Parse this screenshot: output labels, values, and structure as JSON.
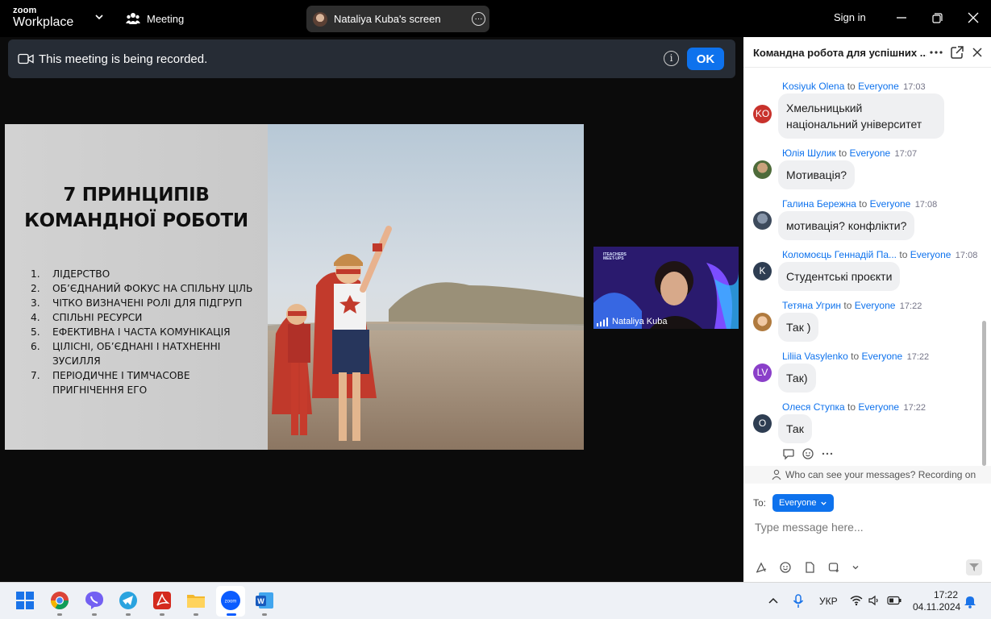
{
  "titlebar": {
    "logo_top": "zoom",
    "logo_bottom": "Workplace",
    "meeting_label": "Meeting",
    "share_label": "Nataliya Kuba's screen",
    "more_glyph": "···",
    "signin_label": "Sign in"
  },
  "recording": {
    "message": "This meeting is being recorded.",
    "info_glyph": "i",
    "ok_label": "OK"
  },
  "slide": {
    "title_line1": "7 ПРИНЦИПІВ",
    "title_line2": "КОМАНДНОЇ РОБОТИ",
    "items": [
      {
        "num": "1.",
        "text": "ЛІДЕРСТВО"
      },
      {
        "num": "2.",
        "text": "ОБ’ЄДНАНИЙ ФОКУС НА СПІЛЬНУ ЦІЛЬ"
      },
      {
        "num": "3.",
        "text": "ЧІТКО ВИЗНАЧЕНІ РОЛІ ДЛЯ ПІДГРУП"
      },
      {
        "num": "4.",
        "text": "СПІЛЬНІ РЕСУРСИ"
      },
      {
        "num": "5.",
        "text": "ЕФЕКТИВНА І ЧАСТА КОМУНІКАЦІЯ"
      },
      {
        "num": "6.",
        "text": "ЦІЛІСНІ, ОБ’ЄДНАНІ І НАТХНЕННІ ЗУСИЛЛЯ"
      },
      {
        "num": "7.",
        "text": "ПЕРІОДИЧНЕ І ТИМЧАСОВЕ ПРИГНІЧЕННЯ ЕГО"
      }
    ]
  },
  "video": {
    "brand_line1": "ITEACHERS",
    "brand_line2": "MEET-UPS",
    "participant_name": "Nataliya Kuba"
  },
  "chat": {
    "title": "Командна робота для успішних ...",
    "to_word": "to",
    "messages": [
      {
        "sender": "Kosiyuk Olena",
        "to": "Everyone",
        "time": "17:03",
        "initials": "KO",
        "avatar_color": "#c8322c",
        "text_line1": "Хмельницький",
        "text_line2": "національний університет"
      },
      {
        "sender": "Юлія Шулик",
        "to": "Everyone",
        "time": "17:07",
        "initials": "",
        "avatar_color": "#4e6b3a",
        "text_line1": "Мотивація?",
        "text_line2": ""
      },
      {
        "sender": "Галина Бережна",
        "to": "Everyone",
        "time": "17:08",
        "initials": "",
        "avatar_color": "#3d4a5c",
        "text_line1": "мотивація? конфлікти?",
        "text_line2": ""
      },
      {
        "sender": "Коломоєць Геннадій Па...",
        "to": "Everyone",
        "time": "17:08",
        "initials": "K",
        "avatar_color": "#2e3d52",
        "text_line1": "Студентські проєкти",
        "text_line2": ""
      },
      {
        "sender": "Тетяна Угрин",
        "to": "Everyone",
        "time": "17:22",
        "initials": "",
        "avatar_color": "#b07a3e",
        "text_line1": "Так )",
        "text_line2": ""
      },
      {
        "sender": "Liliia Vasylenko",
        "to": "Everyone",
        "time": "17:22",
        "initials": "LV",
        "avatar_color": "#8a3fc9",
        "text_line1": "Так)",
        "text_line2": ""
      },
      {
        "sender": "Олеся Ступка",
        "to": "Everyone",
        "time": "17:22",
        "initials": "O",
        "avatar_color": "#2e3d52",
        "text_line1": "Так",
        "text_line2": ""
      }
    ],
    "privacy_note": "Who can see your messages? Recording on",
    "to_label": "To:",
    "recipient": "Everyone",
    "input_placeholder": "Type message here..."
  },
  "taskbar": {
    "language": "УКР",
    "time": "17:22",
    "date": "04.11.2024"
  },
  "colors": {
    "accent": "#0e72ed",
    "banner_bg": "#262c35",
    "chat_bubble": "#eff0f2"
  }
}
